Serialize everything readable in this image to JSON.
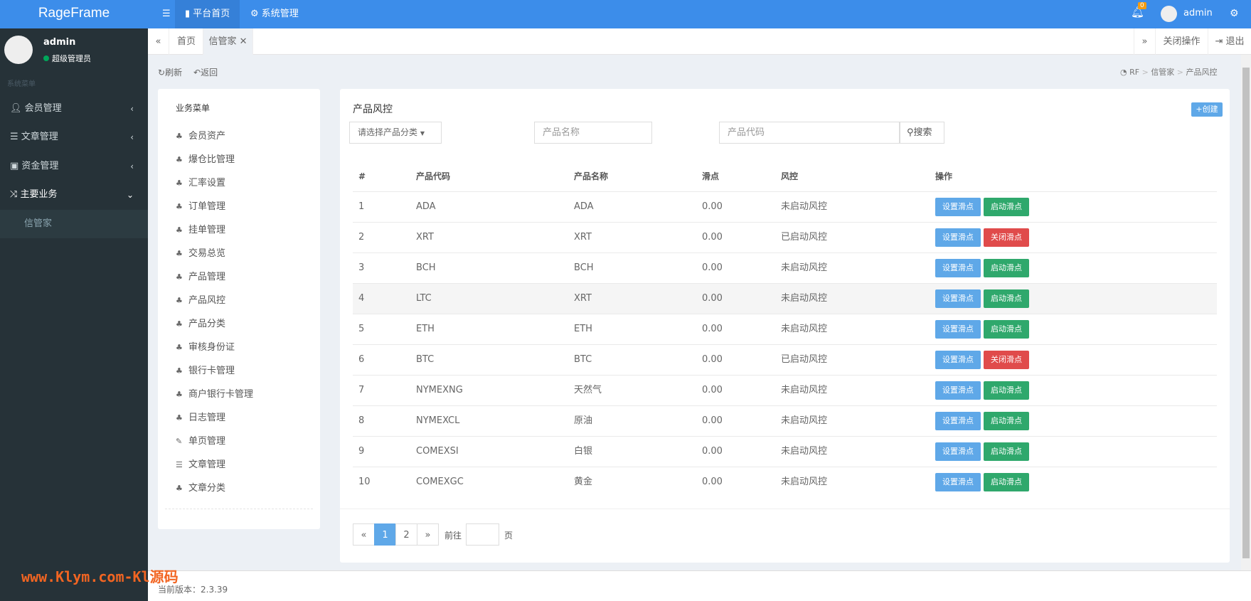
{
  "header": {
    "logo": "RageFrame",
    "menu_icon": "menu-icon",
    "nav": [
      {
        "label": "平台首页",
        "icon": "bookmark-icon"
      },
      {
        "label": "系统管理",
        "icon": "gears-icon"
      }
    ],
    "notifications": "0",
    "user": "admin"
  },
  "sidebar": {
    "user": {
      "name": "admin",
      "role": "超级管理员",
      "status_color": "#00a65a"
    },
    "section": "系统菜单",
    "items": [
      {
        "label": "会员管理",
        "icon": "user-icon"
      },
      {
        "label": "文章管理",
        "icon": "list-icon"
      },
      {
        "label": "资金管理",
        "icon": "money-icon"
      },
      {
        "label": "主要业务",
        "icon": "shuffle-icon"
      }
    ],
    "sub_item": "信管家"
  },
  "tabs": {
    "items": [
      "首页",
      "信管家"
    ],
    "close_ops": "关闭操作",
    "logout": "退出"
  },
  "toolbar": {
    "refresh": "刷新",
    "back": "返回"
  },
  "breadcrumb": [
    "RF",
    "信管家",
    "产品风控"
  ],
  "left_menu": {
    "title": "业务菜单",
    "items": [
      "会员资产",
      "爆仓比管理",
      "汇率设置",
      "订单管理",
      "挂单管理",
      "交易总览",
      "产品管理",
      "产品风控",
      "产品分类",
      "审核身份证",
      "银行卡管理",
      "商户银行卡管理",
      "日志管理",
      "单页管理",
      "文章管理",
      "文章分类"
    ]
  },
  "main": {
    "title": "产品风控",
    "create": "创建",
    "filters": {
      "category_placeholder": "请选择产品分类",
      "name_placeholder": "产品名称",
      "code_placeholder": "产品代码",
      "search": "搜索"
    },
    "columns": [
      "#",
      "产品代码",
      "产品名称",
      "滑点",
      "风控",
      "操作"
    ],
    "rows": [
      {
        "no": "1",
        "code": "ADA",
        "name": "ADA",
        "slip": "0.00",
        "risk": "未启动风控",
        "btn1": "设置滑点",
        "btn2": "启动滑点",
        "active": false
      },
      {
        "no": "2",
        "code": "XRT",
        "name": "XRT",
        "slip": "0.00",
        "risk": "已启动风控",
        "btn1": "设置滑点",
        "btn2": "关闭滑点",
        "active": true
      },
      {
        "no": "3",
        "code": "BCH",
        "name": "BCH",
        "slip": "0.00",
        "risk": "未启动风控",
        "btn1": "设置滑点",
        "btn2": "启动滑点",
        "active": false
      },
      {
        "no": "4",
        "code": "LTC",
        "name": "XRT",
        "slip": "0.00",
        "risk": "未启动风控",
        "btn1": "设置滑点",
        "btn2": "启动滑点",
        "active": false
      },
      {
        "no": "5",
        "code": "ETH",
        "name": "ETH",
        "slip": "0.00",
        "risk": "未启动风控",
        "btn1": "设置滑点",
        "btn2": "启动滑点",
        "active": false
      },
      {
        "no": "6",
        "code": "BTC",
        "name": "BTC",
        "slip": "0.00",
        "risk": "已启动风控",
        "btn1": "设置滑点",
        "btn2": "关闭滑点",
        "active": true
      },
      {
        "no": "7",
        "code": "NYMEXNG",
        "name": "天然气",
        "slip": "0.00",
        "risk": "未启动风控",
        "btn1": "设置滑点",
        "btn2": "启动滑点",
        "active": false
      },
      {
        "no": "8",
        "code": "NYMEXCL",
        "name": "原油",
        "slip": "0.00",
        "risk": "未启动风控",
        "btn1": "设置滑点",
        "btn2": "启动滑点",
        "active": false
      },
      {
        "no": "9",
        "code": "COMEXSI",
        "name": "白银",
        "slip": "0.00",
        "risk": "未启动风控",
        "btn1": "设置滑点",
        "btn2": "启动滑点",
        "active": false
      },
      {
        "no": "10",
        "code": "COMEXGC",
        "name": "黄金",
        "slip": "0.00",
        "risk": "未启动风控",
        "btn1": "设置滑点",
        "btn2": "启动滑点",
        "active": false
      }
    ],
    "pagination": {
      "prev": "«",
      "pages": [
        "1",
        "2"
      ],
      "current": "1",
      "next": "»",
      "goto": "前往",
      "page_suffix": "页"
    }
  },
  "footer": {
    "version": "当前版本：2.3.39"
  },
  "watermark": "www.Klym.com-Kl源码",
  "colors": {
    "primary": "#3c8dea",
    "info": "#5fa8e8",
    "success": "#2fa86c",
    "danger": "#e04b4b",
    "sidebar": "#263238"
  }
}
